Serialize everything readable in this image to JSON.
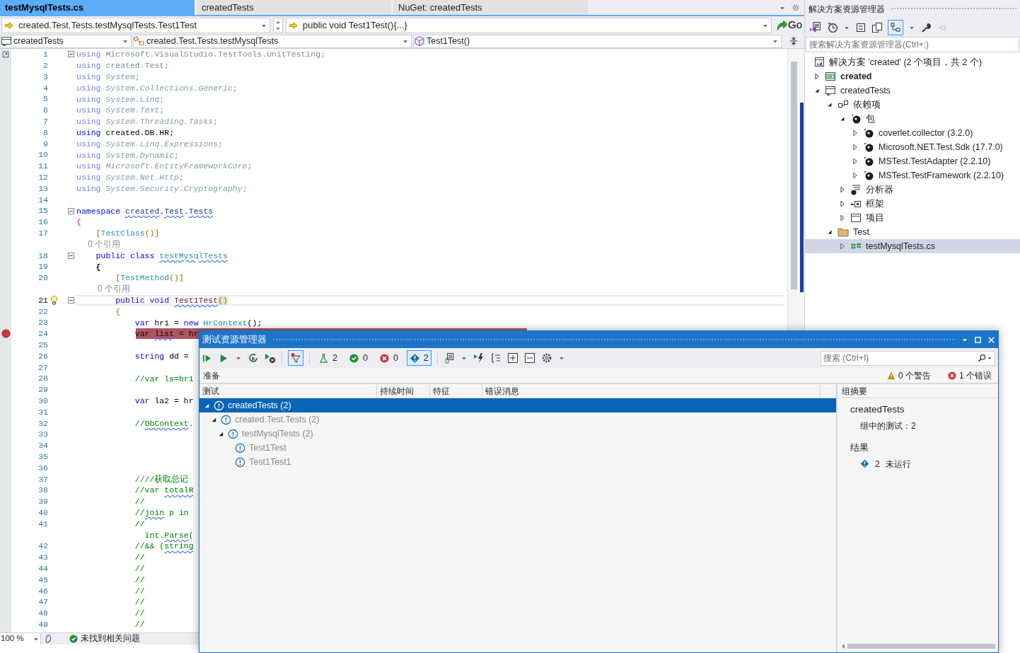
{
  "tabs": [
    {
      "label": "testMysqlTests.cs",
      "selected": true
    },
    {
      "label": "createdTests",
      "selected": false
    },
    {
      "label": "NuGet: createdTests",
      "selected": false
    }
  ],
  "nav_bar": {
    "member_path": "created.Test.Tests.testMysqlTests.Test1Test",
    "member_signature": "public void Test1Test(){...}",
    "go_button": "Go"
  },
  "scope_bar": {
    "project": "createdTests",
    "type": "created.Test.Tests.testMysqlTests",
    "member": "Test1Test()"
  },
  "editor": {
    "lines": [
      {
        "number": "1",
        "fold": true,
        "tokens": [
          {
            "text": "using ",
            "kind": "keyword_dim"
          },
          {
            "text": "Microsoft.VisualStudio.TestTools.UnitTesting;",
            "kind": "name_dim"
          }
        ]
      },
      {
        "number": "2",
        "tokens": [
          {
            "text": "using ",
            "kind": "keyword_dim"
          },
          {
            "text": "created.Test;",
            "kind": "name_dim"
          }
        ]
      },
      {
        "number": "3",
        "tokens": [
          {
            "text": "using ",
            "kind": "keyword_dim"
          },
          {
            "text": "System",
            "kind": "ns_dim"
          },
          {
            "text": ";",
            "kind": "name_dim"
          }
        ]
      },
      {
        "number": "4",
        "tokens": [
          {
            "text": "using ",
            "kind": "keyword_dim"
          },
          {
            "text": "System.Collections.Generic",
            "kind": "ns_dim"
          },
          {
            "text": ";",
            "kind": "name_dim"
          }
        ]
      },
      {
        "number": "5",
        "tokens": [
          {
            "text": "using ",
            "kind": "keyword_dim"
          },
          {
            "text": "System.Linq",
            "kind": "ns_dim"
          },
          {
            "text": ";",
            "kind": "name_dim"
          }
        ]
      },
      {
        "number": "6",
        "tokens": [
          {
            "text": "using ",
            "kind": "keyword_dim"
          },
          {
            "text": "System.Text",
            "kind": "ns_dim"
          },
          {
            "text": ";",
            "kind": "name_dim"
          }
        ]
      },
      {
        "number": "7",
        "tokens": [
          {
            "text": "using ",
            "kind": "keyword_dim"
          },
          {
            "text": "System.Threading.Tasks",
            "kind": "ns_dim"
          },
          {
            "text": ";",
            "kind": "name_dim"
          }
        ]
      },
      {
        "number": "8",
        "tokens": [
          {
            "text": "using ",
            "kind": "keyword"
          },
          {
            "text": "created.DB.HR;",
            "kind": "plain"
          }
        ]
      },
      {
        "number": "9",
        "tokens": [
          {
            "text": "using ",
            "kind": "keyword_dim"
          },
          {
            "text": "System.Linq.Expressions",
            "kind": "ns_dim"
          },
          {
            "text": ";",
            "kind": "name_dim"
          }
        ]
      },
      {
        "number": "10",
        "tokens": [
          {
            "text": "using ",
            "kind": "keyword_dim"
          },
          {
            "text": "System.Dynamic",
            "kind": "ns_dim"
          },
          {
            "text": ";",
            "kind": "name_dim"
          }
        ]
      },
      {
        "number": "11",
        "tokens": [
          {
            "text": "using ",
            "kind": "keyword_dim"
          },
          {
            "text": "Microsoft.EntityFrameworkCore",
            "kind": "ns_dim"
          },
          {
            "text": ";",
            "kind": "name_dim"
          }
        ]
      },
      {
        "number": "12",
        "tokens": [
          {
            "text": "using ",
            "kind": "keyword_dim"
          },
          {
            "text": "System.Net.Http",
            "kind": "ns_dim"
          },
          {
            "text": ";",
            "kind": "name_dim"
          }
        ]
      },
      {
        "number": "13",
        "tokens": [
          {
            "text": "using ",
            "kind": "keyword_dim"
          },
          {
            "text": "System.Security.Cryptography",
            "kind": "ns_dim"
          },
          {
            "text": ";",
            "kind": "name_dim"
          }
        ]
      },
      {
        "number": "14"
      },
      {
        "number": "15",
        "fold": true,
        "tokens": [
          {
            "text": "namespace ",
            "kind": "keyword"
          },
          {
            "text": "created",
            "kind": "ns",
            "squiggle": true
          },
          {
            "text": ".",
            "kind": "plain"
          },
          {
            "text": "Test",
            "kind": "ns",
            "squiggle": true
          },
          {
            "text": ".",
            "kind": "plain"
          },
          {
            "text": "Tests",
            "kind": "ns",
            "squiggle": true
          }
        ]
      },
      {
        "number": "16",
        "tokens": [
          {
            "text": "{",
            "kind": "brace"
          }
        ]
      },
      {
        "number": "17",
        "tokens": [
          {
            "text": "    [",
            "kind": "bracket"
          },
          {
            "text": "TestClass",
            "kind": "type"
          },
          {
            "text": "()]",
            "kind": "bracket"
          }
        ]
      },
      {
        "kind": "codelens",
        "tokens": [
          {
            "text": "    0 个引用",
            "kind": "codelens"
          }
        ]
      },
      {
        "number": "18",
        "fold": true,
        "tokens": [
          {
            "text": "    public class ",
            "kind": "keyword"
          },
          {
            "text": "testMysqlTests",
            "kind": "type",
            "squiggle": true
          }
        ]
      },
      {
        "number": "19",
        "tokens": [
          {
            "text": "    {",
            "kind": "brace_bold"
          }
        ]
      },
      {
        "number": "20",
        "tokens": [
          {
            "text": "        [",
            "kind": "bracket"
          },
          {
            "text": "TestMethod",
            "kind": "type"
          },
          {
            "text": "()]",
            "kind": "bracket"
          }
        ]
      },
      {
        "kind": "codelens",
        "tokens": [
          {
            "text": "        0 个引用",
            "kind": "codelens"
          }
        ]
      },
      {
        "number": "21",
        "fold": true,
        "current": true,
        "lightbulb": true,
        "tokens": [
          {
            "text": "        public void ",
            "kind": "keyword"
          },
          {
            "text": "Test1Test",
            "kind": "method",
            "squiggle": true
          },
          {
            "text": "()",
            "kind": "paren_match"
          }
        ]
      },
      {
        "number": "22",
        "tokens": [
          {
            "text": "        {",
            "kind": "bracket"
          }
        ]
      },
      {
        "number": "23",
        "tokens": [
          {
            "text": "            var",
            "kind": "keyword"
          },
          {
            "text": " hr1 = ",
            "kind": "plain"
          },
          {
            "text": "new ",
            "kind": "keyword"
          },
          {
            "text": "HrContext",
            "kind": "type"
          },
          {
            "text": "();",
            "kind": "plain"
          }
        ]
      },
      {
        "number": "24",
        "breakpoint": true,
        "tokens": [
          {
            "text": "            var ",
            "kind": "breakpoint"
          },
          {
            "text": "list",
            "kind": "breakpoint",
            "squiggle": true
          },
          {
            "text": " = hr",
            "kind": "breakpoint"
          }
        ]
      },
      {
        "number": "25"
      },
      {
        "number": "26",
        "tokens": [
          {
            "text": "            string",
            "kind": "keyword"
          },
          {
            "text": " dd =",
            "kind": "plain"
          }
        ]
      },
      {
        "number": "27"
      },
      {
        "number": "28",
        "tokens": [
          {
            "text": "            //var ls=hr1",
            "kind": "comment"
          }
        ]
      },
      {
        "number": "29"
      },
      {
        "number": "30",
        "tokens": [
          {
            "text": "            var",
            "kind": "keyword"
          },
          {
            "text": " la2 = hr",
            "kind": "plain"
          }
        ]
      },
      {
        "number": "31"
      },
      {
        "number": "32",
        "tokens": [
          {
            "text": "            //",
            "kind": "comment"
          },
          {
            "text": "DbContext",
            "kind": "comment",
            "squiggle": true
          },
          {
            "text": ".",
            "kind": "comment"
          }
        ]
      },
      {
        "number": "33"
      },
      {
        "number": "34"
      },
      {
        "number": "35"
      },
      {
        "number": "36"
      },
      {
        "number": "37",
        "tokens": [
          {
            "text": "            ////获取总记",
            "kind": "comment"
          }
        ]
      },
      {
        "number": "38",
        "tokens": [
          {
            "text": "            //var ",
            "kind": "comment"
          },
          {
            "text": "totalR",
            "kind": "comment",
            "squiggle": true
          }
        ]
      },
      {
        "number": "39",
        "tokens": [
          {
            "text": "            //",
            "kind": "comment"
          }
        ]
      },
      {
        "number": "40",
        "tokens": [
          {
            "text": "            //",
            "kind": "comment"
          },
          {
            "text": "join",
            "kind": "comment",
            "squiggle": true
          },
          {
            "text": " p in",
            "kind": "comment"
          }
        ]
      },
      {
        "number": "41",
        "tokens": [
          {
            "text": "            //",
            "kind": "comment"
          }
        ]
      },
      {
        "tokens": [
          {
            "text": "              int.",
            "kind": "comment"
          },
          {
            "text": "Parse",
            "kind": "comment",
            "squiggle": true
          },
          {
            "text": "(",
            "kind": "comment"
          }
        ]
      },
      {
        "number": "42",
        "tokens": [
          {
            "text": "            //&& (",
            "kind": "comment"
          },
          {
            "text": "string",
            "kind": "comment",
            "squiggle": true
          }
        ]
      },
      {
        "number": "43",
        "tokens": [
          {
            "text": "            //",
            "kind": "comment"
          }
        ]
      },
      {
        "number": "44",
        "tokens": [
          {
            "text": "            //",
            "kind": "comment"
          }
        ]
      },
      {
        "number": "45",
        "tokens": [
          {
            "text": "            //",
            "kind": "comment"
          }
        ]
      },
      {
        "number": "46",
        "tokens": [
          {
            "text": "            //",
            "kind": "comment"
          }
        ]
      },
      {
        "number": "47",
        "tokens": [
          {
            "text": "            //",
            "kind": "comment"
          }
        ]
      },
      {
        "number": "48",
        "tokens": [
          {
            "text": "            //",
            "kind": "comment"
          }
        ]
      },
      {
        "number": "49",
        "tokens": [
          {
            "text": "            //",
            "kind": "comment"
          }
        ]
      }
    ]
  },
  "status_bar": {
    "zoom": "100 %",
    "issues": "未找到相关问题"
  },
  "solution_explorer": {
    "title": "解决方案资源管理器",
    "search_placeholder": "搜索解决方案资源管理器(Ctrl+;)",
    "tree": [
      {
        "label": "解决方案 'created' (2 个项目，共 2 个)",
        "kind": "solution",
        "selected": false,
        "children": [
          {
            "label": "created",
            "kind": "csproj",
            "bold": true,
            "expanded": false,
            "selected": false
          },
          {
            "label": "createdTests",
            "kind": "testproj",
            "expanded": true,
            "selected": false,
            "children": [
              {
                "label": "依赖项",
                "kind": "deps",
                "expanded": true,
                "selected": false,
                "children": [
                  {
                    "label": "包",
                    "kind": "packages",
                    "expanded": true,
                    "selected": false,
                    "children": [
                      {
                        "label": "coverlet.collector (3.2.0)",
                        "kind": "package",
                        "expanded": false,
                        "selected": false
                      },
                      {
                        "label": "Microsoft.NET.Test.Sdk (17.7.0)",
                        "kind": "package",
                        "expanded": false,
                        "selected": false
                      },
                      {
                        "label": "MSTest.TestAdapter (2.2.10)",
                        "kind": "package",
                        "expanded": false,
                        "selected": false
                      },
                      {
                        "label": "MSTest.TestFramework (2.2.10)",
                        "kind": "package",
                        "expanded": false,
                        "selected": false
                      }
                    ]
                  },
                  {
                    "label": "分析器",
                    "kind": "analyzers",
                    "expanded": false,
                    "selected": false
                  },
                  {
                    "label": "框架",
                    "kind": "framework",
                    "expanded": false,
                    "selected": false
                  },
                  {
                    "label": "项目",
                    "kind": "projects",
                    "expanded": false,
                    "selected": false
                  }
                ]
              },
              {
                "label": "Test",
                "kind": "folder",
                "expanded": true,
                "selected": false,
                "children": [
                  {
                    "label": "testMysqlTests.cs",
                    "kind": "csfile",
                    "expanded": false,
                    "selected": true
                  }
                ]
              }
            ]
          }
        ]
      }
    ]
  },
  "test_explorer": {
    "title": "测试资源管理器",
    "filter_active": true,
    "counts": [
      {
        "kind": "total",
        "count": "2",
        "selected": false
      },
      {
        "kind": "passed",
        "count": "0",
        "selected": false
      },
      {
        "kind": "failed",
        "count": "0",
        "selected": false
      },
      {
        "kind": "notrun",
        "count": "2",
        "selected": true
      }
    ],
    "search_placeholder": "搜索 (Ctrl+I)",
    "status": "准备",
    "warnings": "0 个警告",
    "errors": "1 个错误",
    "columns": [
      "测试",
      "持续时间",
      "特征",
      "错误消息"
    ],
    "tree": [
      {
        "label": "createdTests (2)",
        "expanded": true,
        "selected": true,
        "children": [
          {
            "label": "created.Test.Tests (2)",
            "expanded": true,
            "selected": false,
            "children": [
              {
                "label": "testMysqlTests (2)",
                "expanded": true,
                "selected": false,
                "children": [
                  {
                    "label": "Test1Test",
                    "selected": false
                  },
                  {
                    "label": "Test1Test1",
                    "selected": false
                  }
                ]
              }
            ]
          }
        ]
      }
    ],
    "summary": {
      "heading": "组摘要",
      "group": "createdTests",
      "tests_in_group": "组中的测试：2",
      "results_heading": "结果",
      "not_run_count": "2",
      "not_run_label": "未运行"
    }
  }
}
